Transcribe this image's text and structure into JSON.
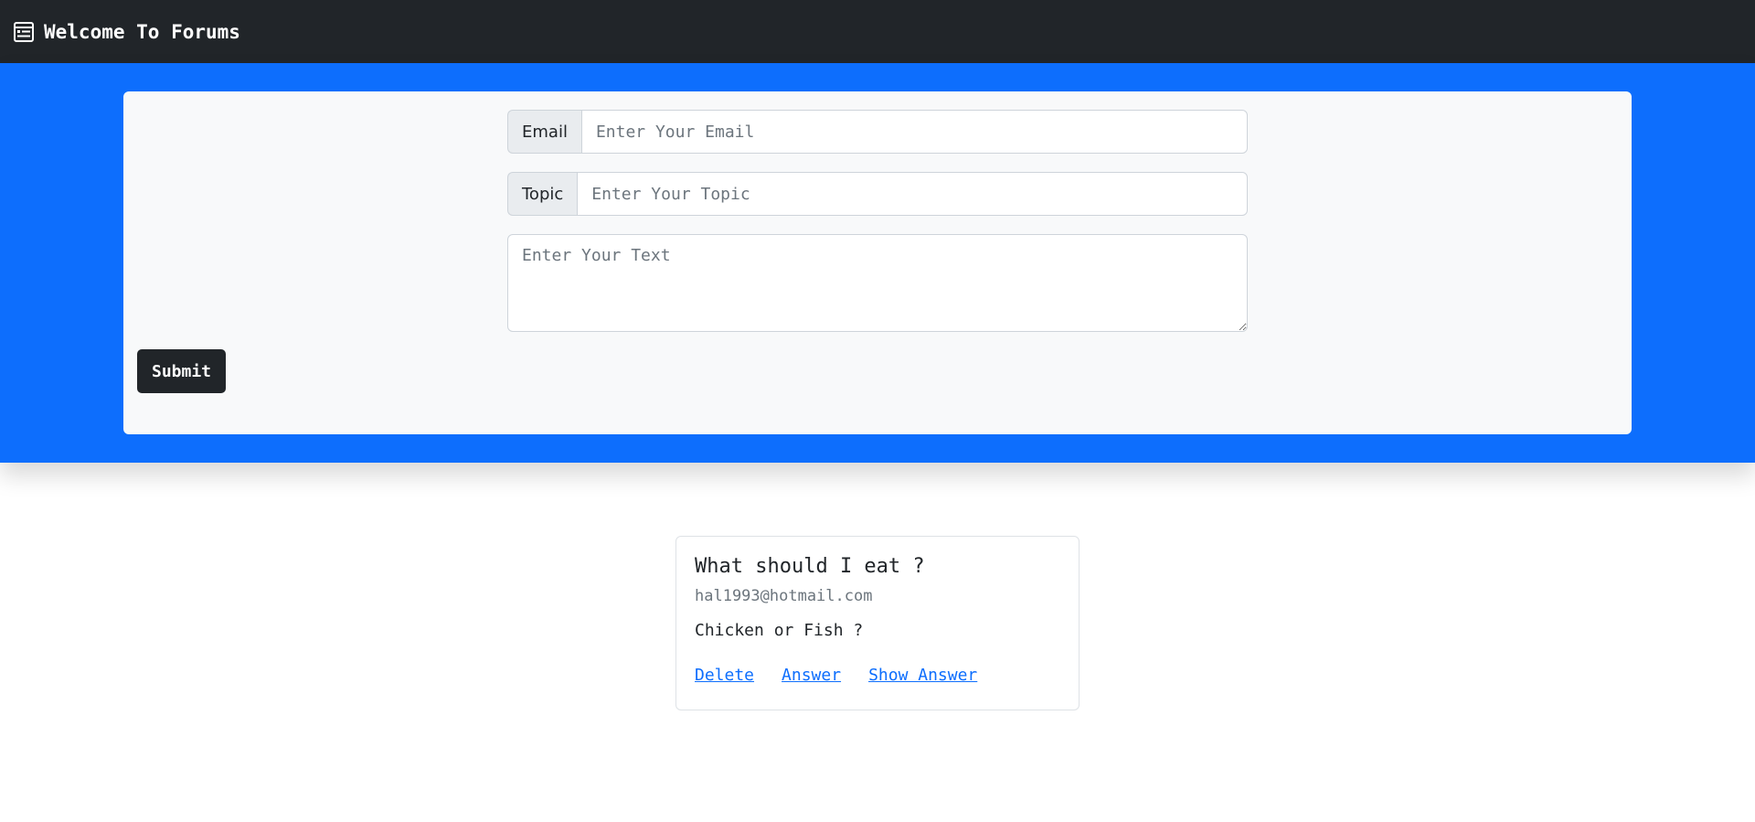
{
  "navbar": {
    "brand_text": "Welcome To Forums",
    "brand_icon": "forum-list-icon"
  },
  "form": {
    "email": {
      "label": "Email",
      "value": "",
      "placeholder": "Enter Your Email"
    },
    "topic": {
      "label": "Topic",
      "value": "",
      "placeholder": "Enter Your Topic"
    },
    "text": {
      "value": "",
      "placeholder": "Enter Your Text"
    },
    "submit_label": "Submit"
  },
  "posts": [
    {
      "title": "What should I eat ?",
      "email": "hal1993@hotmail.com",
      "body": "Chicken or Fish ?",
      "links": {
        "delete": "Delete",
        "answer": "Answer",
        "show_answer": "Show Answer"
      }
    }
  ],
  "colors": {
    "navbar_bg": "#212529",
    "hero_bg": "#0d6efd",
    "panel_bg": "#f8f9fa",
    "link": "#0d6efd"
  }
}
